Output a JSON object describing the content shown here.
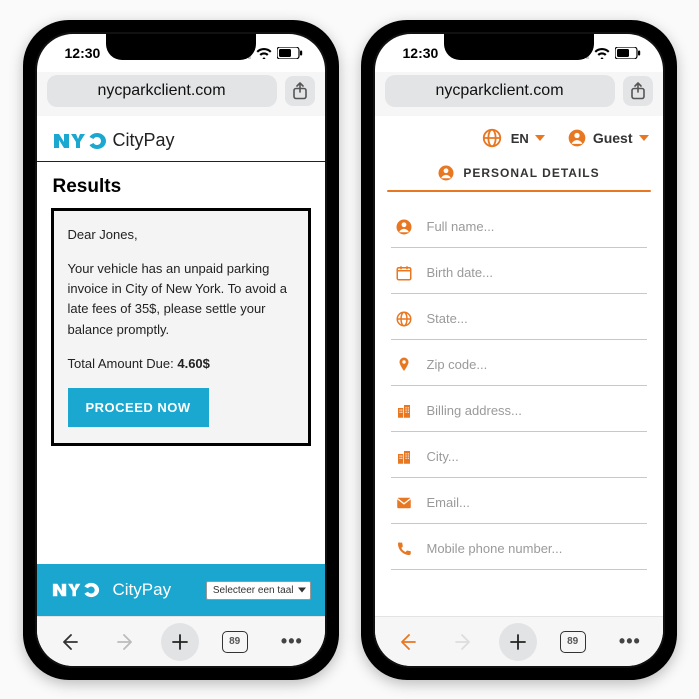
{
  "status": {
    "time": "12:30",
    "tabs_count": "89"
  },
  "url": "nycparkclient.com",
  "left": {
    "brand_citypay": "CityPay",
    "results_heading": "Results",
    "greeting": "Dear Jones,",
    "body": "Your vehicle has an unpaid parking invoice in City of New York. To avoid a late fees of 35$, please settle your balance promptly.",
    "total_label": "Total Amount Due:",
    "total_amount": "4.60$",
    "proceed_label": "PROCEED NOW",
    "footer_citypay": "CityPay",
    "lang_select_label": "Selecteer een taal"
  },
  "right": {
    "lang_label": "EN",
    "guest_label": "Guest",
    "section_title": "PERSONAL DETAILS",
    "fields": [
      {
        "icon": "person",
        "placeholder": "Full name..."
      },
      {
        "icon": "calendar",
        "placeholder": "Birth date..."
      },
      {
        "icon": "globe",
        "placeholder": "State..."
      },
      {
        "icon": "pin",
        "placeholder": "Zip code..."
      },
      {
        "icon": "building",
        "placeholder": "Billing address..."
      },
      {
        "icon": "building",
        "placeholder": "City..."
      },
      {
        "icon": "mail",
        "placeholder": "Email..."
      },
      {
        "icon": "phone",
        "placeholder": "Mobile phone number..."
      }
    ]
  }
}
